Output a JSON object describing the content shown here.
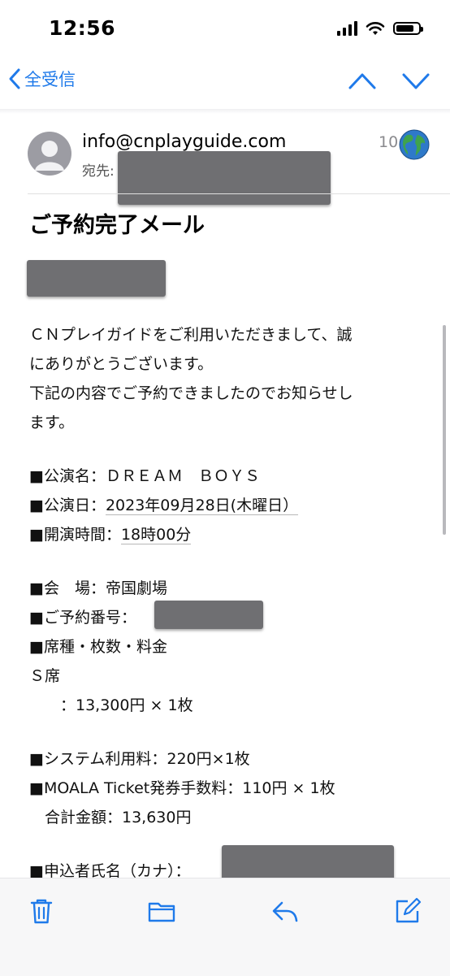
{
  "status_bar": {
    "time": "12:56",
    "battery_fraction": 0.8
  },
  "nav": {
    "back_label": "全受信"
  },
  "email": {
    "sender": "info@cnplayguide.com",
    "to_label": "宛先:",
    "time": "10:",
    "subject": "ご予約完了メール",
    "body": {
      "intro": [
        "ＣＮプレイガイドをご利用いただきまして、誠",
        "にありがとうございます。",
        "下記の内容でご予約できましたのでお知らせし",
        "ます。"
      ],
      "performance_name": "■公演名：ＤＲＥＡＭ　ＢＯＹＳ",
      "performance_date_label": "■公演日：",
      "performance_date_value": "2023年09月28日(木曜日）",
      "start_time_label": "■開演時間：",
      "start_time_value": "18時00分",
      "venue": "■会　場：帝国劇場",
      "reservation_number_label": "■ご予約番号：",
      "seat_header": "■席種・枚数・料金",
      "seat_type": "Ｓ席",
      "seat_price": "　　：13,300円 × 1枚",
      "system_fee": "■システム利用料：220円×1枚",
      "ticket_fee": "■MOALA Ticket発券手数料：110円 × 1枚",
      "total": "　合計金額：13,630円",
      "applicant_label": "■申込者氏名（カナ）："
    }
  },
  "colors": {
    "accent": "#1f7aea",
    "redaction": "#6f6f72"
  }
}
